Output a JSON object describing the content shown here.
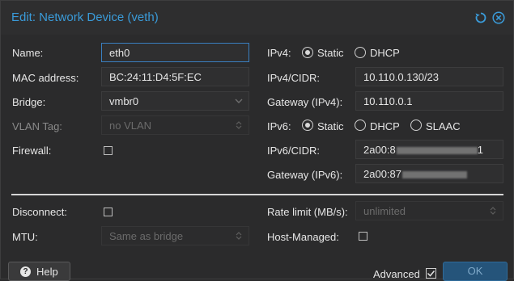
{
  "dialog": {
    "title": "Edit: Network Device (veth)"
  },
  "left": {
    "name_label": "Name:",
    "name_value": "eth0",
    "mac_label": "MAC address:",
    "mac_value": "BC:24:11:D4:5F:EC",
    "bridge_label": "Bridge:",
    "bridge_value": "vmbr0",
    "vlan_label": "VLAN Tag:",
    "vlan_placeholder": "no VLAN",
    "firewall_label": "Firewall:",
    "disconnect_label": "Disconnect:",
    "mtu_label": "MTU:",
    "mtu_placeholder": "Same as bridge"
  },
  "right": {
    "ipv4_label": "IPv4:",
    "ipv4_static": "Static",
    "ipv4_dhcp": "DHCP",
    "ipv4_cidr_label": "IPv4/CIDR:",
    "ipv4_cidr_value": "10.110.0.130/23",
    "gw4_label": "Gateway (IPv4):",
    "gw4_value": "10.110.0.1",
    "ipv6_label": "IPv6:",
    "ipv6_static": "Static",
    "ipv6_dhcp": "DHCP",
    "ipv6_slaac": "SLAAC",
    "ipv6_cidr_label": "IPv6/CIDR:",
    "ipv6_cidr_prefix": "2a00:8",
    "ipv6_cidr_suffix": "1",
    "gw6_label": "Gateway (IPv6):",
    "gw6_prefix": "2a00:87",
    "rate_label": "Rate limit (MB/s):",
    "rate_placeholder": "unlimited",
    "hostmanaged_label": "Host-Managed:"
  },
  "footer": {
    "help_label": "Help",
    "advanced_label": "Advanced",
    "ok_label": "OK"
  },
  "colors": {
    "accent": "#3a9bd9",
    "background": "#2b2b2c",
    "ok_button": "#25547a"
  },
  "icons": [
    "reset-icon",
    "close-icon",
    "question-icon",
    "chevron-down-icon",
    "spinner-icon"
  ]
}
